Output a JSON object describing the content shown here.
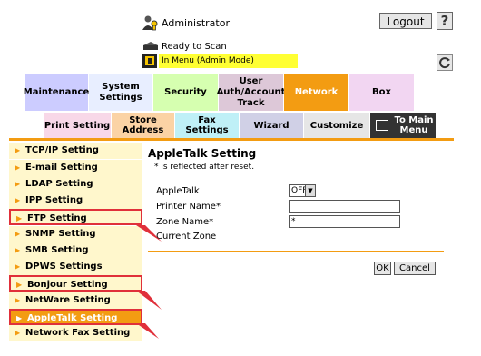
{
  "header": {
    "admin_label": "Administrator",
    "logout_label": "Logout",
    "help_label": "?",
    "status_label": "Ready to Scan",
    "mode_label": "In Menu (Admin Mode)"
  },
  "top_tabs": [
    {
      "label": "Maintenance",
      "color": "#ccccff"
    },
    {
      "label": "System Settings",
      "color": "#e8eeff"
    },
    {
      "label": "Security",
      "color": "#d6ffb0"
    },
    {
      "label": "User Auth/Account Track",
      "color": "#ddc8d8"
    },
    {
      "label": "Network",
      "color": "#f39c12"
    },
    {
      "label": "Box",
      "color": "#f2d6f2"
    }
  ],
  "sub_tabs": [
    {
      "label": "Print Setting",
      "color": "#f8d8e8"
    },
    {
      "label": "Store Address",
      "color": "#fbd3a5"
    },
    {
      "label": "Fax Settings",
      "color": "#bff0f7"
    },
    {
      "label": "Wizard",
      "color": "#d0d0e6"
    },
    {
      "label": "Customize",
      "color": "#e6e6e6"
    },
    {
      "label": "To Main Menu",
      "color": "#333333"
    }
  ],
  "sidebar": {
    "items": [
      {
        "label": "TCP/IP Setting"
      },
      {
        "label": "E-mail Setting"
      },
      {
        "label": "LDAP Setting"
      },
      {
        "label": "IPP Setting"
      },
      {
        "label": "FTP Setting"
      },
      {
        "label": "SNMP Setting"
      },
      {
        "label": "SMB Setting"
      },
      {
        "label": "DPWS Settings"
      },
      {
        "label": "Bonjour Setting"
      },
      {
        "label": "NetWare Setting"
      },
      {
        "label": "AppleTalk Setting"
      },
      {
        "label": "Network Fax Setting"
      }
    ]
  },
  "content": {
    "title": "AppleTalk Setting",
    "note": "* is reflected after reset.",
    "fields": {
      "appletalk_label": "AppleTalk",
      "appletalk_value": "OFF",
      "printer_name_label": "Printer Name*",
      "printer_name_value": "",
      "zone_name_label": "Zone Name*",
      "zone_name_value": "*",
      "current_zone_label": "Current Zone"
    },
    "ok_label": "OK",
    "cancel_label": "Cancel"
  },
  "accent_color": "#f39c12",
  "highlight_color": "#e0303a"
}
